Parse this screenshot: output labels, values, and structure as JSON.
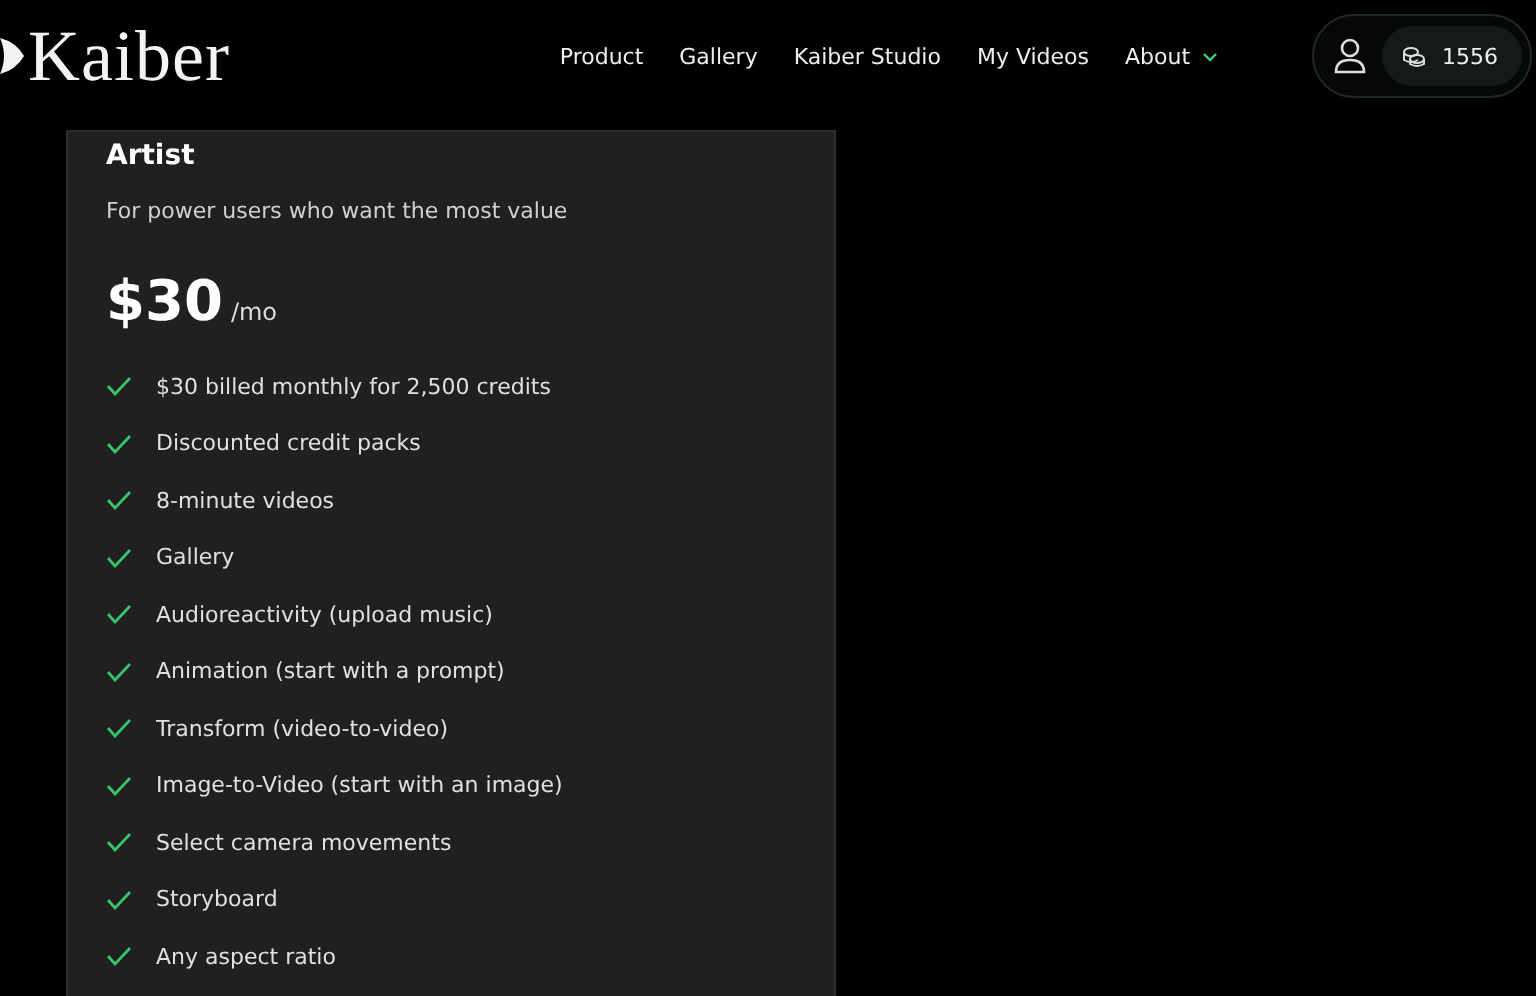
{
  "header": {
    "logo": "Kaiber",
    "nav": [
      {
        "label": "Product",
        "dropdown": false
      },
      {
        "label": "Gallery",
        "dropdown": false
      },
      {
        "label": "Kaiber Studio",
        "dropdown": false
      },
      {
        "label": "My Videos",
        "dropdown": false
      },
      {
        "label": "About",
        "dropdown": true
      }
    ],
    "credits": "1556"
  },
  "plan": {
    "name": "Artist",
    "description": "For power users who want the most value",
    "price": "$30",
    "period": "/mo",
    "features": [
      "$30 billed monthly for 2,500 credits",
      "Discounted credit packs",
      "8-minute videos",
      "Gallery",
      "Audioreactivity (upload music)",
      "Animation (start with a prompt)",
      "Transform (video-to-video)",
      "Image-to-Video (start with an image)",
      "Select camera movements",
      "Storyboard",
      "Any aspect ratio"
    ]
  }
}
